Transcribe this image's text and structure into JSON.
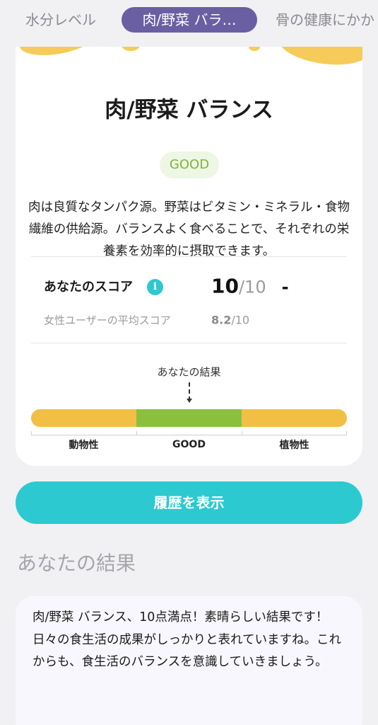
{
  "tabs": [
    {
      "label": "水分レベル"
    },
    {
      "label": "肉/野菜 バラ…"
    },
    {
      "label": "骨の健康にかか"
    }
  ],
  "card": {
    "title": "肉/野菜 バランス",
    "badge": "GOOD",
    "description": "肉は良質なタンパク源。野菜はビタミン・ミネラル・食物繊維の供給源。バランスよく食べることで、それぞれの栄養素を効率的に摂取できます。",
    "score_label": "あなたのスコア",
    "info_icon": "i",
    "score_value": "10",
    "score_denominator": "/10",
    "score_trend": "-",
    "avg_label": "女性ユーザーの平均スコア",
    "avg_value": "8.2",
    "avg_denominator": "/10",
    "marker_label": "あなたの結果",
    "segments": [
      {
        "label": "動物性",
        "color": "#f2bf45"
      },
      {
        "label": "GOOD",
        "color": "#8bc03f"
      },
      {
        "label": "植物性",
        "color": "#f2bf45"
      }
    ],
    "result_position": 0.5
  },
  "history_button": "履歴を表示",
  "result_section": {
    "title": "あなたの結果",
    "text": "肉/野菜 バランス、10点満点！素晴らしい結果です！日々の食生活の成果がしっかりと表れていますね。これからも、食生活のバランスを意識していきましょう。"
  },
  "colors": {
    "accent": "#2cc9d1",
    "tab_active": "#6b5fa3",
    "good": "#7db33f"
  }
}
